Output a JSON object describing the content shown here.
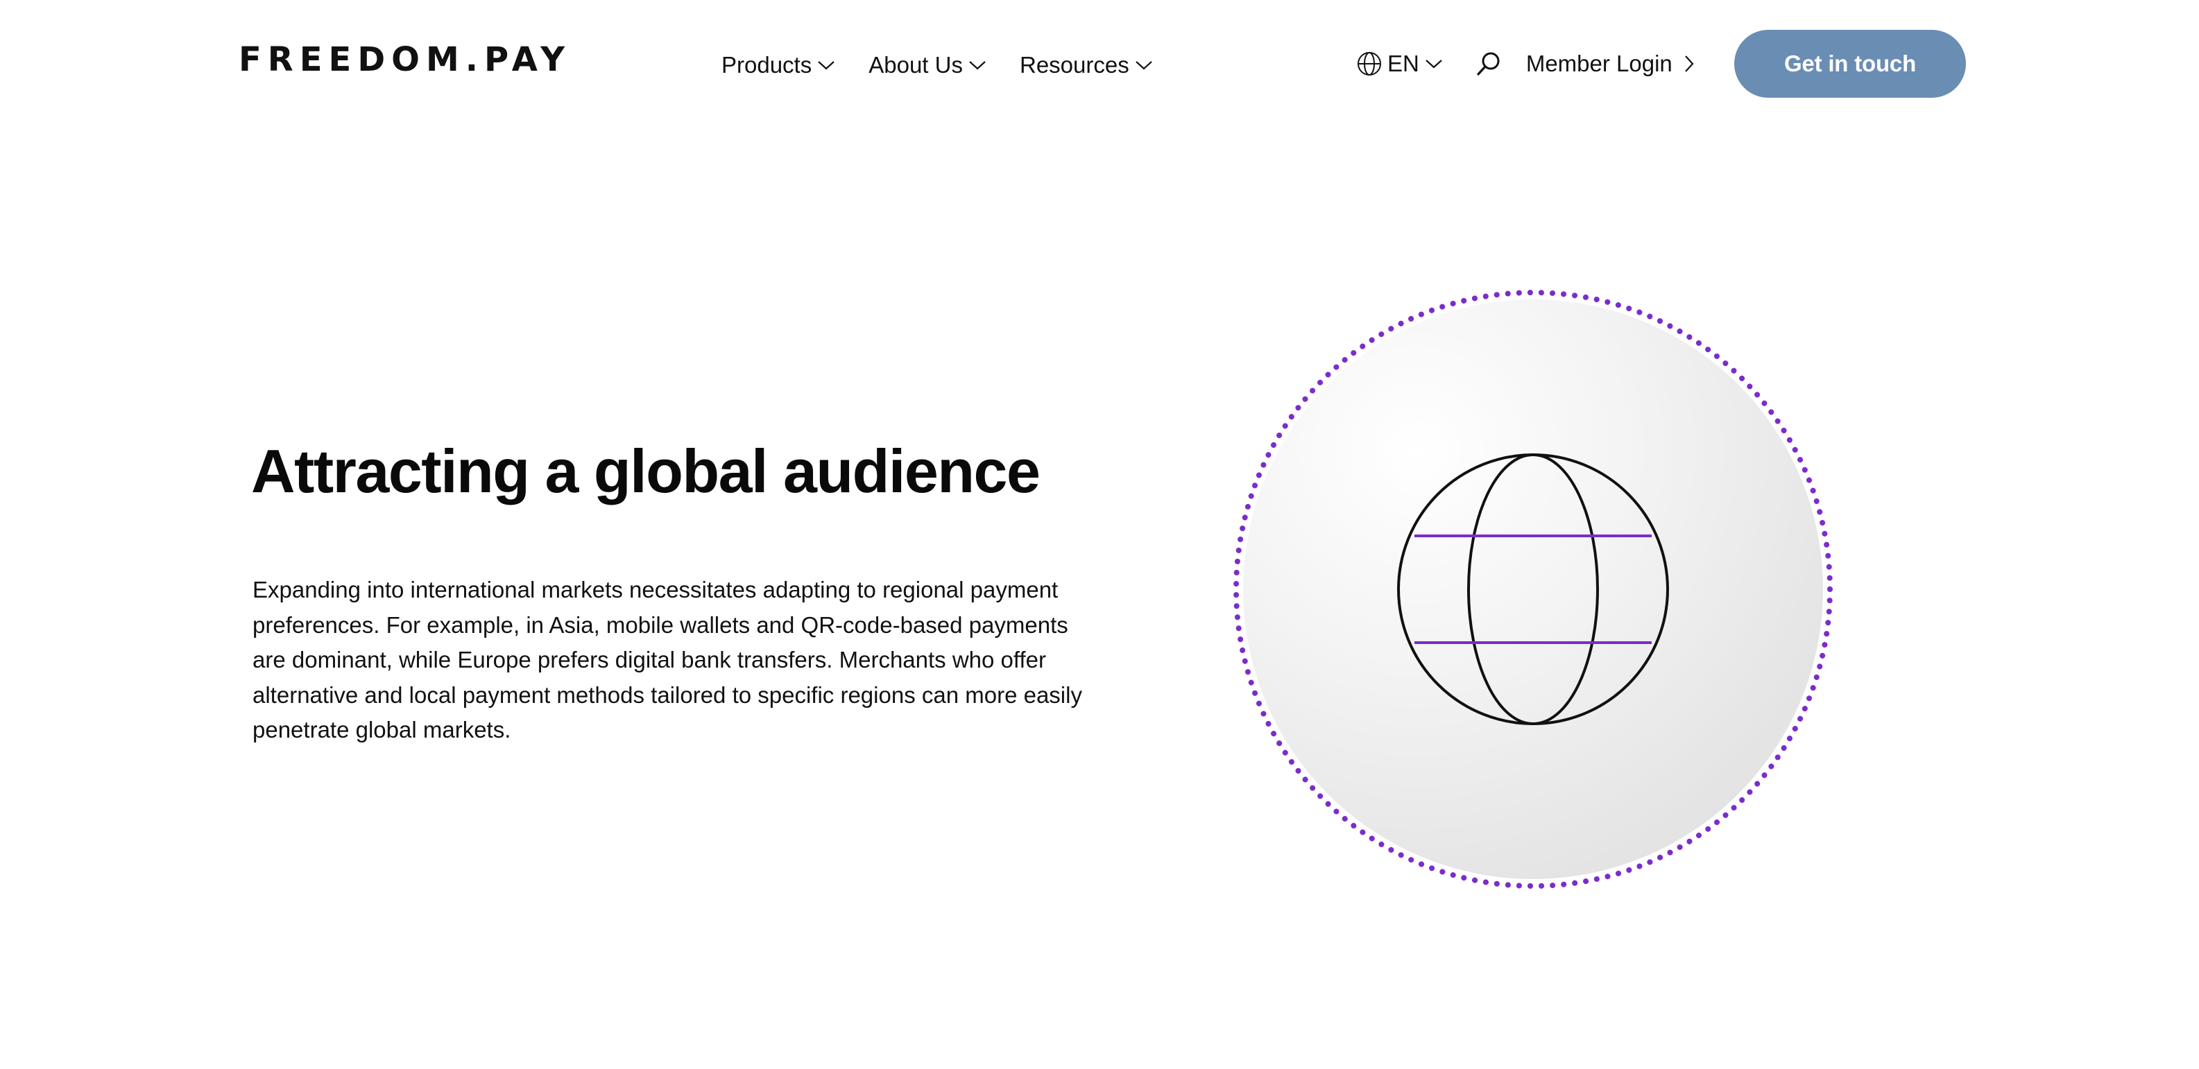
{
  "header": {
    "logo_text": "FREEDOM.PAY",
    "nav": [
      {
        "label": "Products"
      },
      {
        "label": "About Us"
      },
      {
        "label": "Resources"
      }
    ],
    "language": {
      "label": "EN",
      "icon": "globe-icon"
    },
    "search_icon": "search-icon",
    "member_login": {
      "label": "Member Login",
      "icon": "chevron-right-icon"
    },
    "cta_label": "Get in touch"
  },
  "hero": {
    "title": "Attracting a global audience",
    "body": "Expanding into international markets necessitates adapting to regional payment preferences. For example, in Asia, mobile wallets and QR-code-based payments are dominant, while Europe prefers digital bank transfers. Merchants who offer alternative and local payment methods tailored to specific regions can more easily penetrate global markets."
  },
  "illustration": {
    "icon": "globe-icon",
    "dotted_ring_color": "#7b2ccc",
    "latitude_line_color": "#7b2ccc"
  },
  "colors": {
    "cta_background": "#6a8db4",
    "accent_purple": "#7b2ccc",
    "text": "#111111"
  }
}
